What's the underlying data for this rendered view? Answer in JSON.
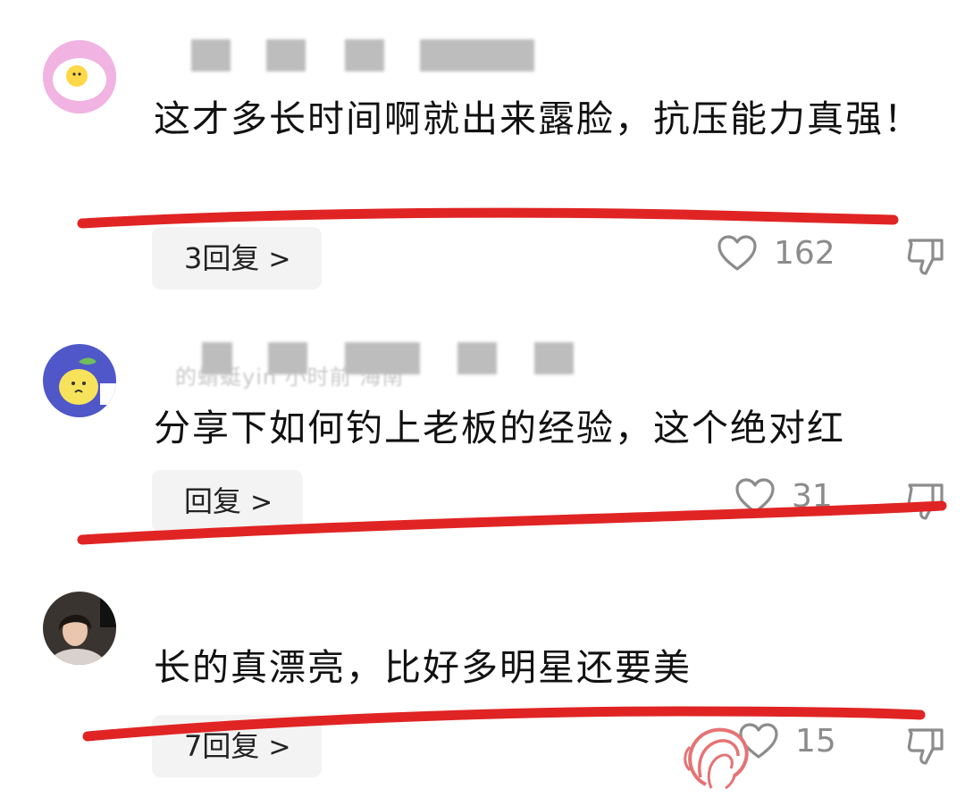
{
  "comments": [
    {
      "text": "这才多长时间啊就出来露脸，抗压能力真强！",
      "reply_label": "3回复",
      "likes": "162"
    },
    {
      "username_fragment": "的蜻蜓yin 小时前 海南",
      "text": "分享下如何钓上老板的经验，这个绝对红",
      "reply_label": "回复",
      "likes": "31"
    },
    {
      "text": "长的真漂亮，比好多明星还要美",
      "reply_label": "7回复",
      "likes": "15"
    }
  ],
  "chevron": ">",
  "colors": {
    "underline": "#e02424",
    "reply_bg": "#f3f3f3",
    "meta_gray": "#8c8c8c"
  },
  "icons": [
    "heart-outline-icon",
    "thumbs-down-icon",
    "chevron-right-icon",
    "watermark-logo-icon"
  ]
}
